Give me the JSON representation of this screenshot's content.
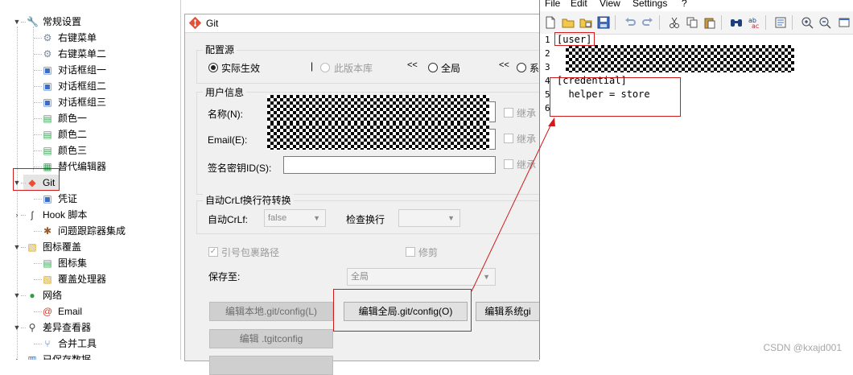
{
  "tree": {
    "items": [
      {
        "label": "常规设置",
        "icon": "wrench-icon",
        "expander": "▼"
      },
      {
        "label": "右键菜单",
        "icon": "gear-icon"
      },
      {
        "label": "右键菜单二",
        "icon": "gear-icon"
      },
      {
        "label": "对话框组一",
        "icon": "window-icon"
      },
      {
        "label": "对话框组二",
        "icon": "window-icon"
      },
      {
        "label": "对话框组三",
        "icon": "window-icon"
      },
      {
        "label": "颜色一",
        "icon": "palette-icon"
      },
      {
        "label": "颜色二",
        "icon": "palette-icon"
      },
      {
        "label": "颜色三",
        "icon": "palette-icon"
      },
      {
        "label": "替代编辑器",
        "icon": "editor-icon"
      },
      {
        "label": "Git",
        "icon": "git-icon",
        "expander": "▼"
      },
      {
        "label": "凭证",
        "icon": "credential-icon"
      },
      {
        "label": "Hook 脚本",
        "icon": "hook-icon",
        "expander": "›"
      },
      {
        "label": "问题跟踪器集成",
        "icon": "bug-icon"
      },
      {
        "label": "图标覆盖",
        "icon": "overlay-icon",
        "expander": "▼"
      },
      {
        "label": "图标集",
        "icon": "iconset-icon"
      },
      {
        "label": "覆盖处理器",
        "icon": "overlay-handler-icon"
      },
      {
        "label": "网络",
        "icon": "network-icon",
        "expander": "▼"
      },
      {
        "label": "Email",
        "icon": "email-icon"
      },
      {
        "label": "差异查看器",
        "icon": "magnifier-icon",
        "expander": "▼"
      },
      {
        "label": "合并工具",
        "icon": "merge-icon"
      },
      {
        "label": "已保存数据",
        "icon": "saved-data-icon",
        "expander": "›"
      }
    ]
  },
  "panel": {
    "title": "Git",
    "config_source": {
      "title": "配置源",
      "effective": "实际生效",
      "local": "此版本库",
      "global": "全局",
      "system": "系",
      "arrow": "<<",
      "separator": "|"
    },
    "user_info": {
      "title": "用户信息",
      "name_label": "名称(N):",
      "email_label": "Email(E):",
      "signing_label": "签名密钥ID(S):",
      "inherit": "继承"
    },
    "crlf": {
      "title": "自动CrLf换行符转换",
      "autocrlf_label": "自动CrLf:",
      "autocrlf_value": "false",
      "safecrlf_label": "检查换行",
      "safecrlf_value": ""
    },
    "quote_path": "引号包裹路径",
    "prune": "修剪",
    "save_to_label": "保存至:",
    "save_to_value": "全局",
    "buttons": {
      "edit_local": "编辑本地.git/config(L)",
      "edit_global": "编辑全局.git/config(O)",
      "edit_system": "编辑系统gi",
      "edit_tgitconfig": "编辑 .tgitconfig"
    }
  },
  "editor": {
    "menu": [
      "File",
      "Edit",
      "View",
      "Settings",
      "?"
    ],
    "toolbar_icons": [
      "new-file-icon",
      "open-icon",
      "open-folder-icon",
      "save-icon",
      "undo-icon",
      "redo-icon",
      "cut-icon",
      "copy-icon",
      "paste-icon",
      "find-icon",
      "replace-icon",
      "properties-icon",
      "zoom-in-icon",
      "zoom-out-icon",
      "maximize-icon"
    ],
    "line_numbers": [
      "1",
      "2",
      "3",
      "4",
      "5",
      "6"
    ],
    "lines": [
      "[user]",
      "",
      "",
      "[credential]",
      "  helper = store",
      ""
    ]
  },
  "watermark": "CSDN @kxajd001",
  "colors": {
    "annotation_red": "#d11a1a",
    "panel_bg": "#f0f0f0"
  }
}
